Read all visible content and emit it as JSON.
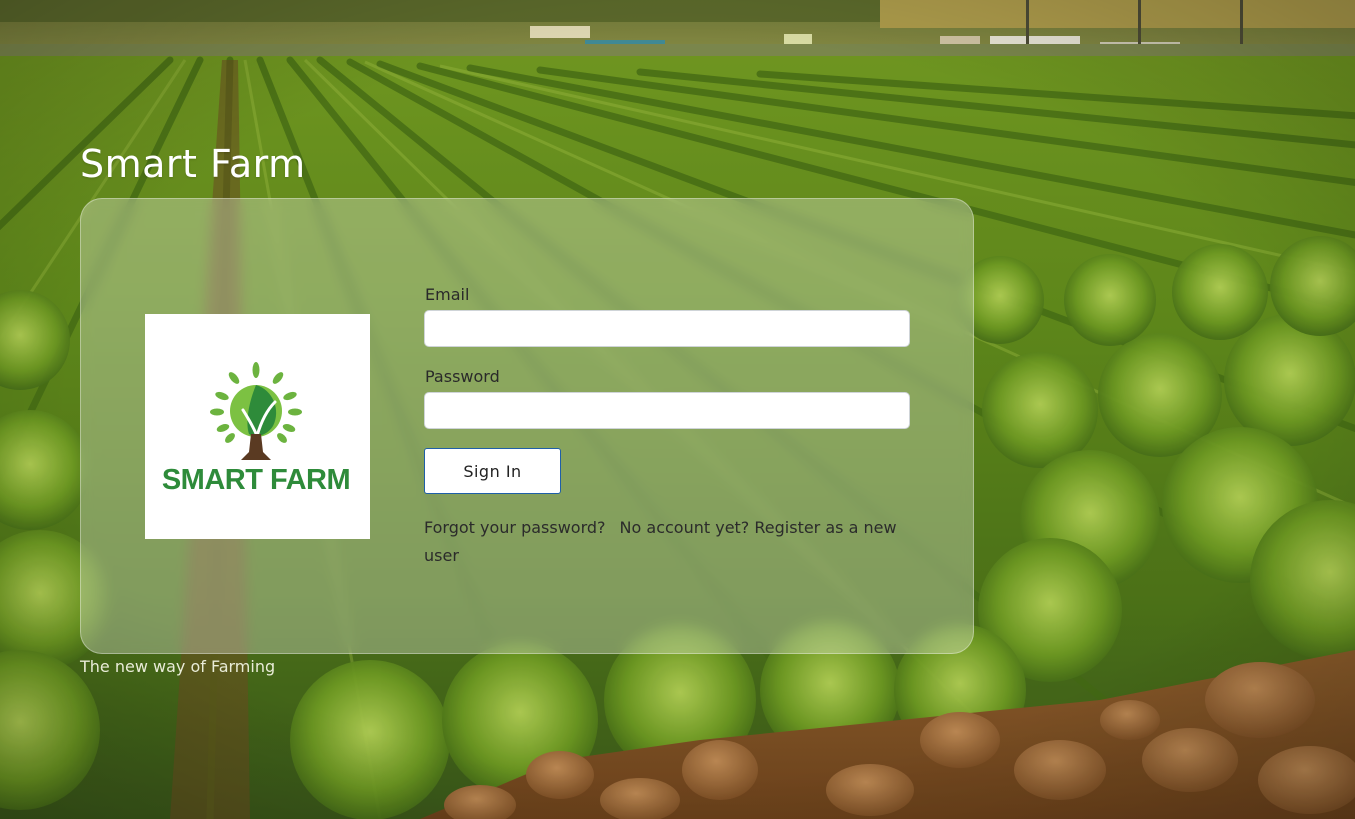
{
  "app": {
    "title": "Smart Farm",
    "tagline": "The new way of Farming"
  },
  "logo": {
    "text": "SMART FARM",
    "icon": "tree-leaf-icon",
    "color_primary": "#2e8b3a",
    "color_light": "#7cc142",
    "color_trunk": "#5a3a22"
  },
  "form": {
    "email": {
      "label": "Email",
      "value": "",
      "placeholder": ""
    },
    "password": {
      "label": "Password",
      "value": "",
      "placeholder": ""
    },
    "signin_label": "Sign In",
    "forgot_password_label": "Forgot your password?",
    "register_label": "No account yet? Register as a new user"
  },
  "theme": {
    "button_border": "#1f5fa8",
    "card_tint": "rgba(255,255,255,0.30)",
    "title_color": "#ffffff"
  },
  "background": {
    "scene": "lettuce-field-photo"
  }
}
